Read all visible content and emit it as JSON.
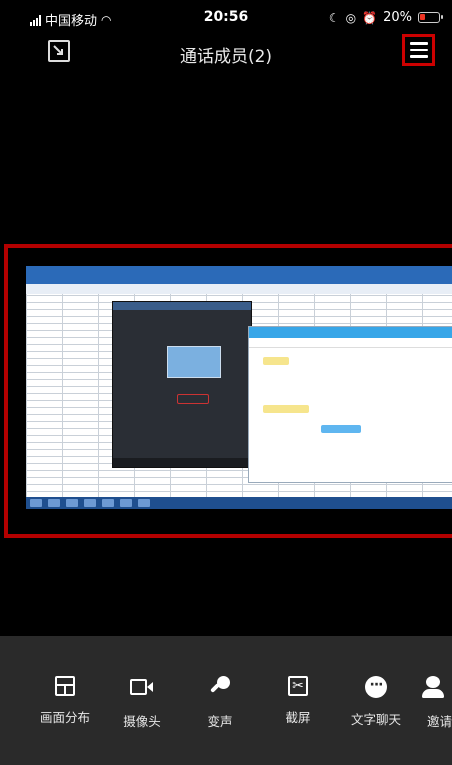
{
  "status_bar": {
    "carrier": "中国移动",
    "time": "20:56",
    "battery": "20%",
    "icons": [
      "signal-icon",
      "wifi-icon",
      "moon-icon",
      "lock-rotation-icon",
      "alarm-icon",
      "battery-icon"
    ]
  },
  "header": {
    "title": "通话成员(2)",
    "left_icon": "minimize-window-icon",
    "right_icon": "menu-icon"
  },
  "shared_screen": {
    "description_icon": "screen-share-view"
  },
  "toolbar": {
    "items": [
      {
        "label": "画面分布",
        "icon": "layout-icon"
      },
      {
        "label": "摄像头",
        "icon": "camera-icon"
      },
      {
        "label": "变声",
        "icon": "voice-changer-icon"
      },
      {
        "label": "截屏",
        "icon": "screenshot-icon"
      },
      {
        "label": "文字聊天",
        "icon": "chat-bubble-icon"
      },
      {
        "label": "邀请",
        "icon": "invite-icon"
      }
    ]
  },
  "colors": {
    "background": "#000000",
    "toolbar_bg": "#2a2a2a",
    "highlight_border": "#cc0000"
  }
}
